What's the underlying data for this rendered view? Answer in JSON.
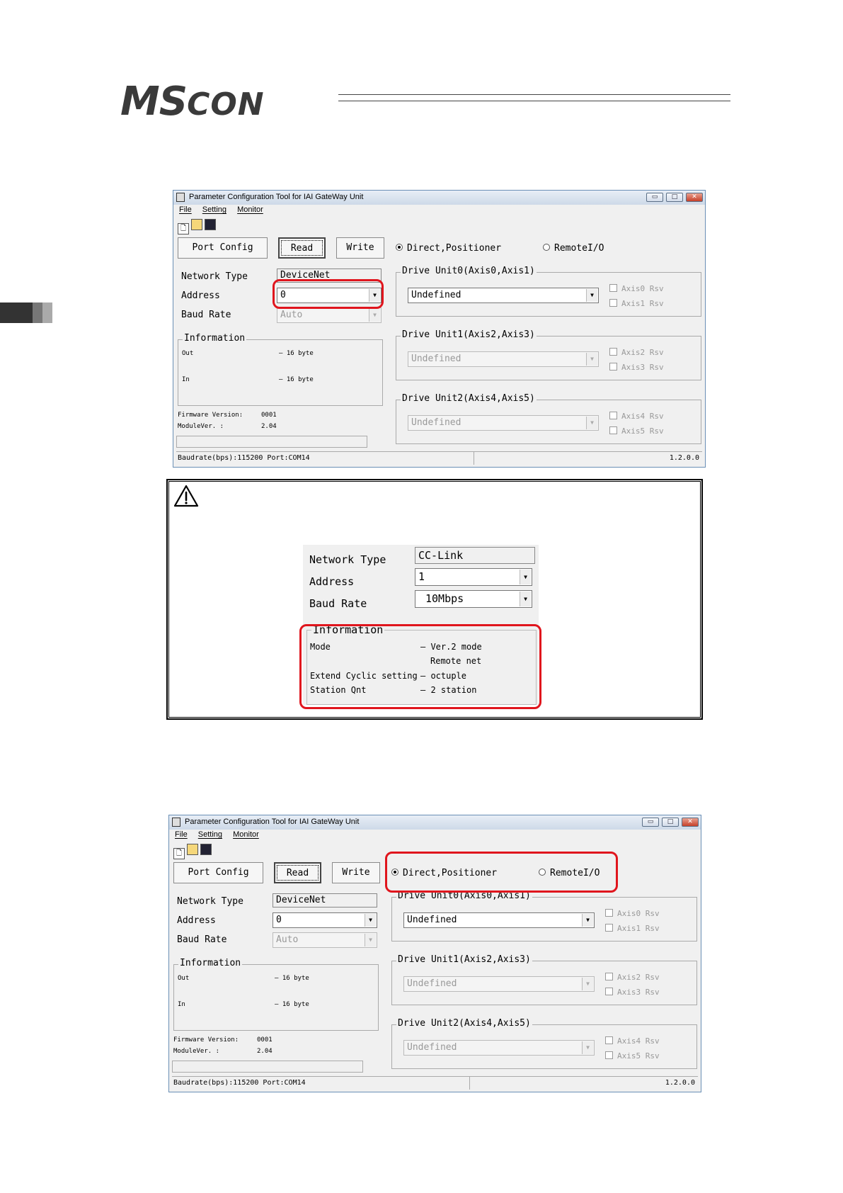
{
  "header": {
    "logo_main": "MS",
    "logo_rest": "CON"
  },
  "window": {
    "title": "Parameter Configuration Tool for IAI GateWay Unit",
    "menu": [
      "File",
      "Setting",
      "Monitor"
    ],
    "buttons": {
      "port_config": "Port Config",
      "read": "Read",
      "write": "Write"
    },
    "mode": {
      "direct": "Direct,Positioner",
      "remote": "RemoteI/O"
    },
    "network_type_label": "Network Type",
    "network_type_value": "DeviceNet",
    "address_label": "Address",
    "address_value": "0",
    "baud_rate_label": "Baud Rate",
    "baud_rate_value": "Auto",
    "information": {
      "title": "Information",
      "out_label": "Out",
      "out_value": "– 16 byte",
      "in_label": "In",
      "in_value": "– 16 byte"
    },
    "firmware_label": "Firmware Version:",
    "firmware_value": "0001",
    "module_label": "ModuleVer. :",
    "module_value": "2.04",
    "drive_units": [
      {
        "title": "Drive Unit0(Axis0,Axis1)",
        "value": "Undefined",
        "chk1": "Axis0 Rsv",
        "chk2": "Axis1 Rsv"
      },
      {
        "title": "Drive Unit1(Axis2,Axis3)",
        "value": "Undefined",
        "chk1": "Axis2 Rsv",
        "chk2": "Axis3 Rsv"
      },
      {
        "title": "Drive Unit2(Axis4,Axis5)",
        "value": "Undefined",
        "chk1": "Axis4 Rsv",
        "chk2": "Axis5 Rsv"
      }
    ],
    "status_left": "Baudrate(bps):115200   Port:COM14",
    "status_right": "1.2.0.0"
  },
  "caution": {
    "network_type_label": "Network Type",
    "network_type_value": "CC-Link",
    "address_label": "Address",
    "address_value": "1",
    "baud_rate_label": "Baud Rate",
    "baud_rate_value": "10Mbps",
    "information_title": "Information",
    "rows": [
      {
        "label": "Mode",
        "value": "– Ver.2 mode"
      },
      {
        "label": "",
        "value": "Remote net"
      },
      {
        "label": "Extend Cyclic setting",
        "value": "– octuple"
      },
      {
        "label": "Station Qnt",
        "value": "– 2 station"
      }
    ]
  },
  "icons": [
    "app-icon",
    "new-file-icon",
    "open-folder-icon",
    "save-icon",
    "warning-icon"
  ]
}
